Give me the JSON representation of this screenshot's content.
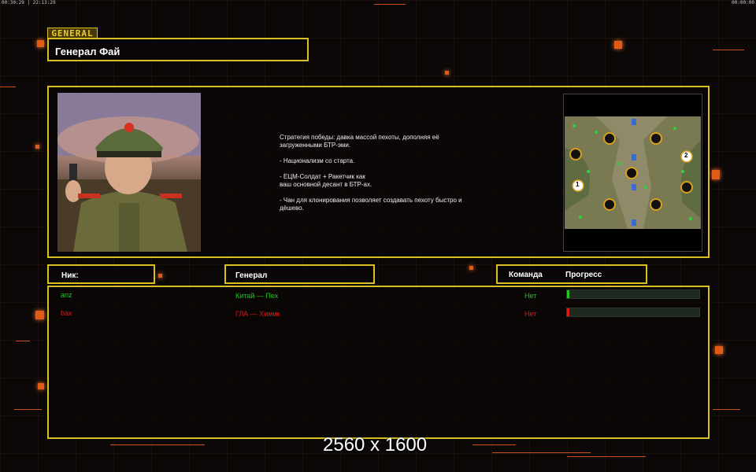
{
  "hud": {
    "top_left": "00:30:29 | 22:13:29",
    "top_right": "00:00:00"
  },
  "general_tag": "GENERAL",
  "title": "Генерал Фай",
  "description": {
    "paragraphs": [
      "Стратегия победы: давка массой пехоты, дополняя её\n загруженными БТР-эми.",
      "- Национализм со старта.",
      "- ЕЦМ-Солдат + Ракетчик как\nваш основной десант в БТР-ах.",
      "- Чан для клонирования позволяет создавать пехоту быстро и\n дёшево."
    ]
  },
  "minimap": {
    "start_labels": [
      "1",
      "2"
    ]
  },
  "table": {
    "headers": {
      "nick": "Ник:",
      "general": "Генерал",
      "team": "Команда",
      "progress": "Прогресс"
    },
    "rows": [
      {
        "nick": "anz",
        "general": "Китай — Пех",
        "team": "Нет",
        "color": "#22c822",
        "progress": 0.02
      },
      {
        "nick": "bax",
        "general": "ГЛА — Химик",
        "team": "Нет",
        "color": "#e01818",
        "progress": 0.01
      }
    ]
  },
  "resolution_label": "2560 x 1600",
  "colors": {
    "frame": "#d8c024",
    "accent": "#e05a18"
  }
}
